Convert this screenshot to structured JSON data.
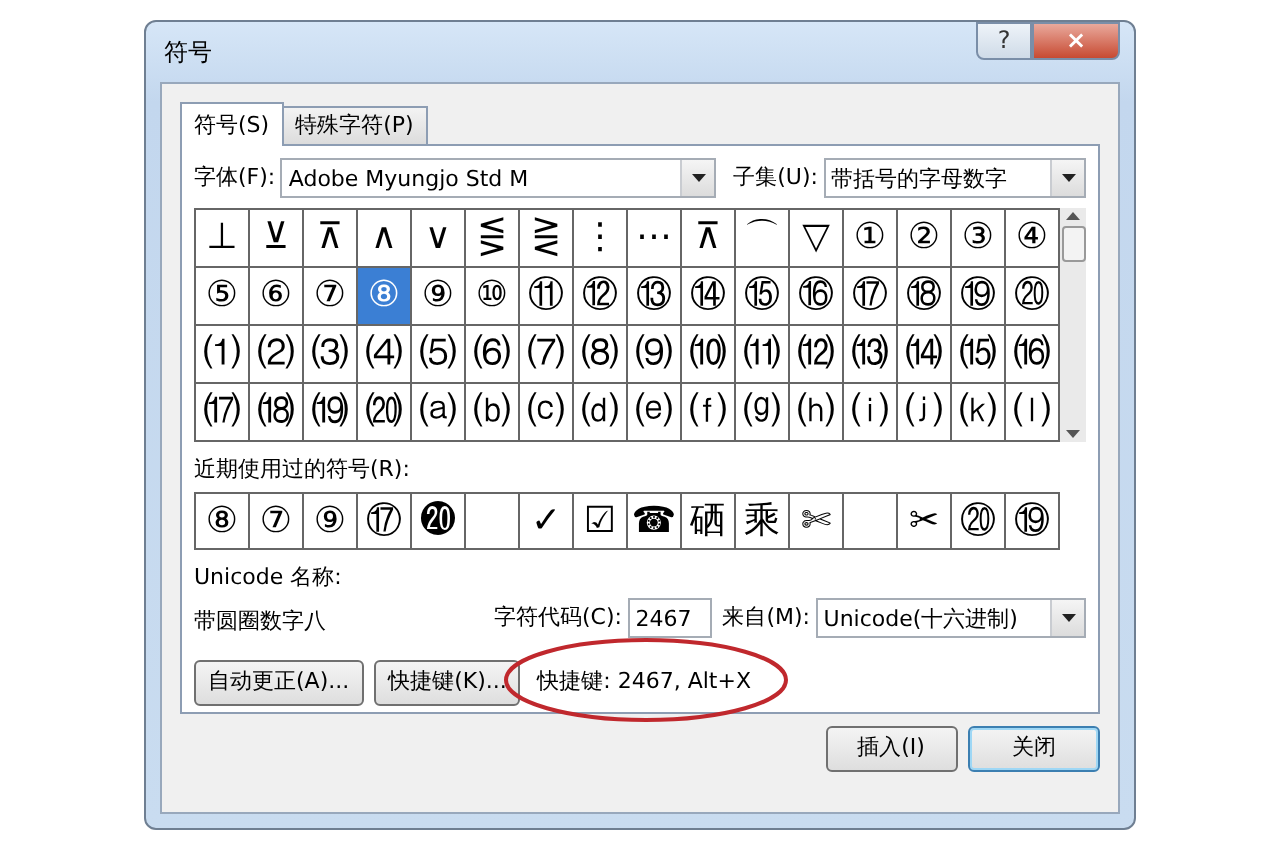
{
  "window": {
    "title": "符号",
    "help_button": "?",
    "close_button": "×"
  },
  "tabs": [
    {
      "label": "符号(S)",
      "selected": true
    },
    {
      "label": "特殊字符(P)",
      "selected": false
    }
  ],
  "font": {
    "label": "字体(F):",
    "value": "Adobe Myungjo Std M"
  },
  "subset": {
    "label": "子集(U):",
    "value": "带括号的字母数字"
  },
  "symbol_grid": [
    [
      {
        "symbol": "⊥",
        "selected": false
      },
      {
        "symbol": "⊻",
        "selected": false
      },
      {
        "symbol": "⊼",
        "selected": false
      },
      {
        "symbol": "∧",
        "selected": false
      },
      {
        "symbol": "∨",
        "selected": false
      },
      {
        "symbol": "⋚",
        "selected": false
      },
      {
        "symbol": "⋛",
        "selected": false
      },
      {
        "symbol": "⋮",
        "selected": false
      },
      {
        "symbol": "⋯",
        "selected": false
      },
      {
        "symbol": "⊼",
        "selected": false
      },
      {
        "symbol": "⌒",
        "selected": false
      },
      {
        "symbol": "▽",
        "selected": false
      },
      {
        "symbol": "①",
        "selected": false
      },
      {
        "symbol": "②",
        "selected": false
      },
      {
        "symbol": "③",
        "selected": false
      },
      {
        "symbol": "④",
        "selected": false
      }
    ],
    [
      {
        "symbol": "⑤",
        "selected": false
      },
      {
        "symbol": "⑥",
        "selected": false
      },
      {
        "symbol": "⑦",
        "selected": false
      },
      {
        "symbol": "⑧",
        "selected": true
      },
      {
        "symbol": "⑨",
        "selected": false
      },
      {
        "symbol": "⑩",
        "selected": false
      },
      {
        "symbol": "⑪",
        "selected": false
      },
      {
        "symbol": "⑫",
        "selected": false
      },
      {
        "symbol": "⑬",
        "selected": false
      },
      {
        "symbol": "⑭",
        "selected": false
      },
      {
        "symbol": "⑮",
        "selected": false
      },
      {
        "symbol": "⑯",
        "selected": false
      },
      {
        "symbol": "⑰",
        "selected": false
      },
      {
        "symbol": "⑱",
        "selected": false
      },
      {
        "symbol": "⑲",
        "selected": false
      },
      {
        "symbol": "⑳",
        "selected": false
      }
    ],
    [
      {
        "symbol": "⑴",
        "selected": false
      },
      {
        "symbol": "⑵",
        "selected": false
      },
      {
        "symbol": "⑶",
        "selected": false
      },
      {
        "symbol": "⑷",
        "selected": false
      },
      {
        "symbol": "⑸",
        "selected": false
      },
      {
        "symbol": "⑹",
        "selected": false
      },
      {
        "symbol": "⑺",
        "selected": false
      },
      {
        "symbol": "⑻",
        "selected": false
      },
      {
        "symbol": "⑼",
        "selected": false
      },
      {
        "symbol": "⑽",
        "selected": false
      },
      {
        "symbol": "⑾",
        "selected": false
      },
      {
        "symbol": "⑿",
        "selected": false
      },
      {
        "symbol": "⒀",
        "selected": false
      },
      {
        "symbol": "⒁",
        "selected": false
      },
      {
        "symbol": "⒂",
        "selected": false
      },
      {
        "symbol": "⒃",
        "selected": false
      }
    ],
    [
      {
        "symbol": "⒄",
        "selected": false
      },
      {
        "symbol": "⒅",
        "selected": false
      },
      {
        "symbol": "⒆",
        "selected": false
      },
      {
        "symbol": "⒇",
        "selected": false
      },
      {
        "symbol": "⒜",
        "selected": false
      },
      {
        "symbol": "⒝",
        "selected": false
      },
      {
        "symbol": "⒞",
        "selected": false
      },
      {
        "symbol": "⒟",
        "selected": false
      },
      {
        "symbol": "⒠",
        "selected": false
      },
      {
        "symbol": "⒡",
        "selected": false
      },
      {
        "symbol": "⒢",
        "selected": false
      },
      {
        "symbol": "⒣",
        "selected": false
      },
      {
        "symbol": "⒤",
        "selected": false
      },
      {
        "symbol": "⒥",
        "selected": false
      },
      {
        "symbol": "⒦",
        "selected": false
      },
      {
        "symbol": "⒧",
        "selected": false
      }
    ]
  ],
  "recent": {
    "label": "近期使用过的符号(R):",
    "items": [
      {
        "kind": "symbol",
        "symbol": "⑧"
      },
      {
        "kind": "symbol",
        "symbol": "⑦"
      },
      {
        "kind": "symbol",
        "symbol": "⑨"
      },
      {
        "kind": "symbol",
        "symbol": "⑰"
      },
      {
        "kind": "symbol",
        "symbol": "⓴"
      },
      {
        "kind": "empty"
      },
      {
        "kind": "symbol",
        "symbol": "✓"
      },
      {
        "kind": "symbol",
        "symbol": "☑"
      },
      {
        "kind": "symbol",
        "symbol": "☎"
      },
      {
        "kind": "symbol",
        "symbol": "硒"
      },
      {
        "kind": "symbol",
        "symbol": "乘"
      },
      {
        "kind": "symbol",
        "symbol": "✄"
      },
      {
        "kind": "empty"
      },
      {
        "kind": "symbol",
        "symbol": "✂"
      },
      {
        "kind": "symbol",
        "symbol": "⑳"
      },
      {
        "kind": "symbol",
        "symbol": "⑲"
      }
    ]
  },
  "unicode_name": {
    "label": "Unicode 名称:",
    "value": "带圆圈数字八"
  },
  "char_code": {
    "label": "字符代码(C):",
    "value": "2467"
  },
  "from": {
    "label": "来自(M):",
    "value": "Unicode(十六进制)"
  },
  "buttons": [
    {
      "label": "自动更正(A)..."
    },
    {
      "label": "快捷键(K)..."
    }
  ],
  "shortcut_text": "快捷键: 2467, Alt+X",
  "footer_buttons": [
    {
      "label": "插入(I)",
      "default": false
    },
    {
      "label": "关闭",
      "default": true
    }
  ]
}
